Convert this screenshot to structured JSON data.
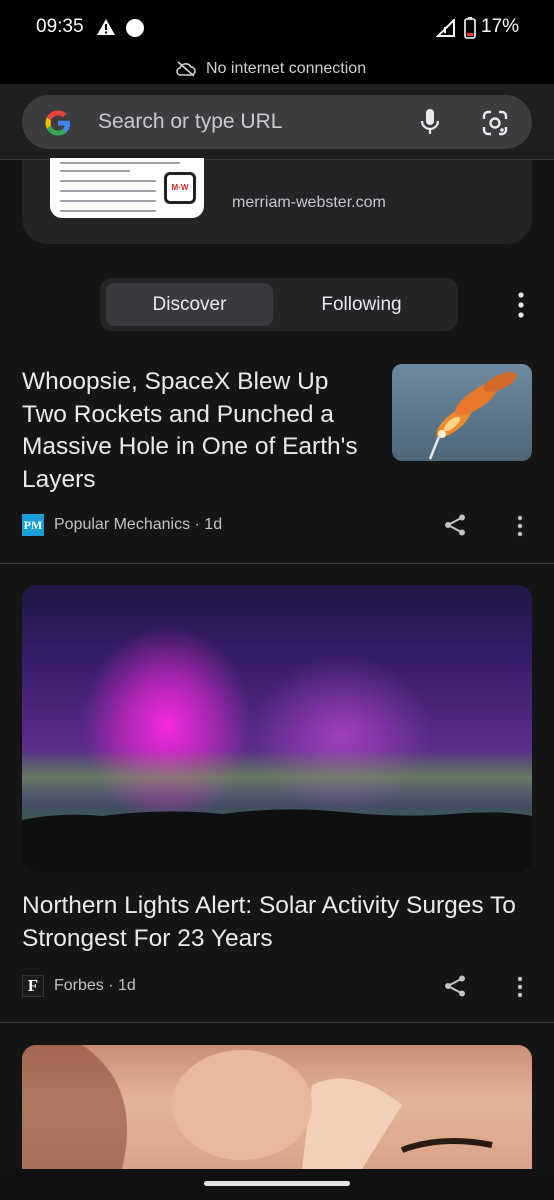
{
  "status_bar": {
    "time": "09:35",
    "battery": "17%"
  },
  "offline_banner": "No internet connection",
  "omnibox": {
    "placeholder": "Search or type URL"
  },
  "previous_card": {
    "domain": "merriam-webster.com"
  },
  "feed_tabs": {
    "discover": "Discover",
    "following": "Following",
    "active": "Discover"
  },
  "articles": [
    {
      "title": "Whoopsie, SpaceX Blew Up Two Rockets and Punched a Massive Hole in One of Earth's Layers",
      "source": "Popular Mechanics",
      "age": "1d",
      "logo_text": "PM"
    },
    {
      "title": "Northern Lights Alert: Solar Activity Surges To Strongest For 23 Years",
      "source": "Forbes",
      "age": "1d",
      "logo_text": "F"
    }
  ],
  "colors": {
    "background": "#151515",
    "omnibox": "#3c3d3f",
    "accent_pm": "#1aa0d8"
  }
}
